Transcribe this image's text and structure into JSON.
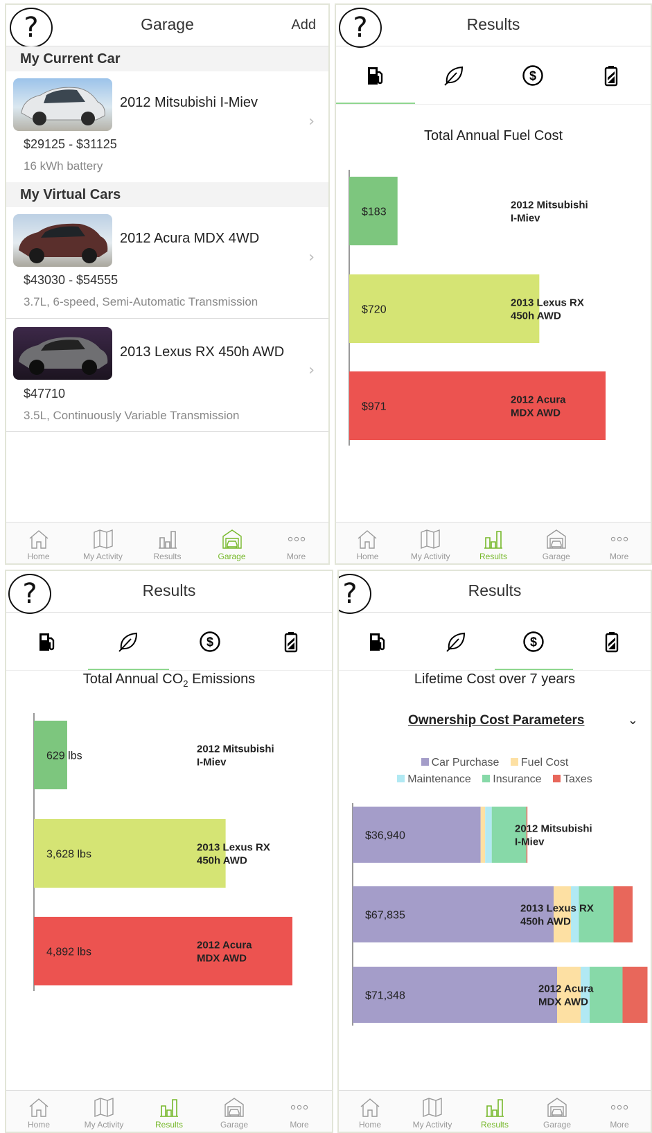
{
  "garage": {
    "title": "Garage",
    "help": "?",
    "add": "Add",
    "current_header": "My Current Car",
    "virtual_header": "My Virtual Cars",
    "cars": [
      {
        "name": "2012 Mitsubishi I-Miev",
        "price": "$29125 - $31125",
        "spec": "16 kWh battery"
      },
      {
        "name": "2012 Acura MDX 4WD",
        "price": "$43030 - $54555",
        "spec": "3.7L, 6-speed, Semi-Automatic Transmission"
      },
      {
        "name": "2013 Lexus RX 450h AWD",
        "price": "$47710",
        "spec": "3.5L, Continuously Variable Transmission"
      }
    ]
  },
  "tabs": [
    "Home",
    "My Activity",
    "Results",
    "Garage",
    "More"
  ],
  "results_title": "Results",
  "colors": {
    "green": "#7dc67e",
    "yellow": "#d5e474",
    "red": "#ec5350",
    "accent": "#76b82a",
    "purchase": "#a49dc9",
    "fuel": "#fde0a3",
    "maintenance": "#b1e9f3",
    "insurance": "#87d9a8",
    "taxes": "#e8675b"
  },
  "fuel_chart": {
    "title": "Total Annual Fuel Cost",
    "labels": [
      "$183",
      "$720",
      "$971"
    ]
  },
  "co2_chart": {
    "title_pre": "Total Annual CO",
    "title_sub": "2",
    "title_post": " Emissions",
    "labels": [
      "629 lbs",
      "3,628 lbs",
      "4,892 lbs"
    ]
  },
  "lifetime_chart": {
    "title": "Lifetime Cost over 7 years",
    "params_label": "Ownership Cost Parameters",
    "legend": [
      "Car Purchase",
      "Fuel Cost",
      "Maintenance",
      "Insurance",
      "Taxes"
    ],
    "labels": [
      "$36,940",
      "$67,835",
      "$71,348"
    ]
  },
  "chart_data": [
    {
      "type": "bar",
      "title": "Total Annual Fuel Cost",
      "categories": [
        "2012 Mitsubishi I-Miev",
        "2013 Lexus RX 450h AWD",
        "2012 Acura MDX AWD"
      ],
      "values": [
        183,
        720,
        971
      ],
      "xlim": [
        0,
        971
      ]
    },
    {
      "type": "bar",
      "title": "Total Annual CO2 Emissions",
      "categories": [
        "2012 Mitsubishi I-Miev",
        "2013 Lexus RX 450h AWD",
        "2012 Acura MDX AWD"
      ],
      "values": [
        629,
        3628,
        4892
      ],
      "xlim": [
        0,
        4892
      ]
    },
    {
      "type": "bar",
      "title": "Lifetime Cost over 7 years",
      "categories": [
        "2012 Mitsubishi I-Miev",
        "2013 Lexus RX 450h AWD",
        "2012 Acura MDX AWD"
      ],
      "series": [
        {
          "name": "Car Purchase",
          "values": [
            36940,
            58000,
            59000
          ]
        },
        {
          "name": "Fuel Cost",
          "values": [
            1300,
            5000,
            6800
          ]
        },
        {
          "name": "Maintenance",
          "values": [
            1900,
            2300,
            2600
          ]
        },
        {
          "name": "Insurance",
          "values": [
            10000,
            10000,
            9500
          ]
        },
        {
          "name": "Taxes",
          "values": [
            300,
            5500,
            7200
          ]
        }
      ],
      "totals": [
        36940,
        67835,
        71348
      ],
      "xlim": [
        0,
        88000
      ]
    }
  ]
}
